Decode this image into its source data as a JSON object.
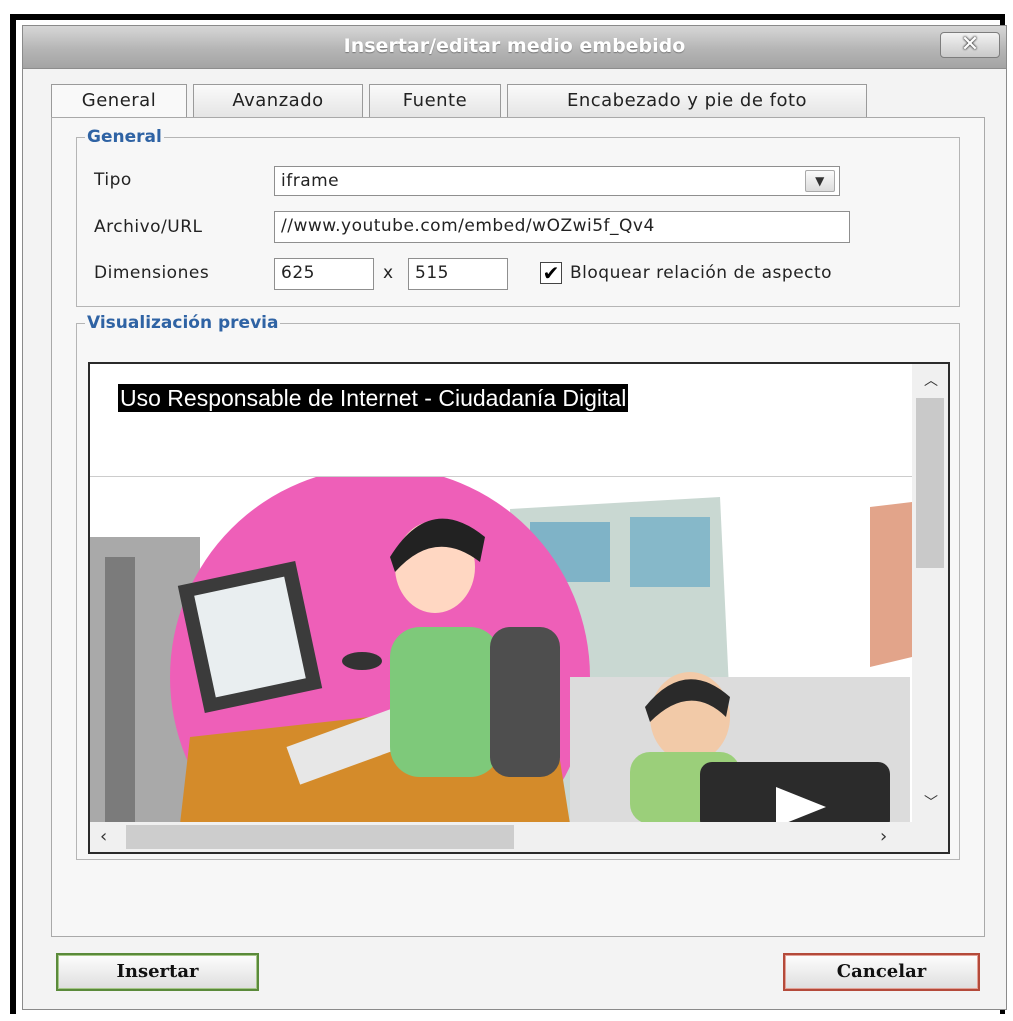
{
  "dialog": {
    "title": "Insertar/editar medio embebido",
    "close_label": "✕"
  },
  "tabs": [
    {
      "label": "General",
      "active": true
    },
    {
      "label": "Avanzado",
      "active": false
    },
    {
      "label": "Fuente",
      "active": false
    },
    {
      "label": "Encabezado y pie de foto",
      "active": false
    }
  ],
  "general": {
    "legend": "General",
    "tipo_label": "Tipo",
    "tipo_value": "iframe",
    "url_label": "Archivo/URL",
    "url_value": "//www.youtube.com/embed/wOZwi5f_Qv4",
    "dim_label": "Dimensiones",
    "width": "625",
    "times": "x",
    "height": "515",
    "lock_checked": true,
    "lock_label": "Bloquear relación de aspecto"
  },
  "preview": {
    "legend": "Visualización previa",
    "video_title": "Uso Responsable de Internet - Ciudadanía Digital"
  },
  "buttons": {
    "insert": "Insertar",
    "cancel": "Cancelar"
  },
  "colors": {
    "legend": "#2f63a4",
    "insert_border": "#5a8a3a",
    "cancel_border": "#b44a3a",
    "thumbnail_pink": "#ee5fb8",
    "thumbnail_shirt": "#7ec97a"
  },
  "icons": {
    "select_arrow": "chevron-down-icon",
    "checkbox": "check-icon",
    "play": "play-icon"
  }
}
